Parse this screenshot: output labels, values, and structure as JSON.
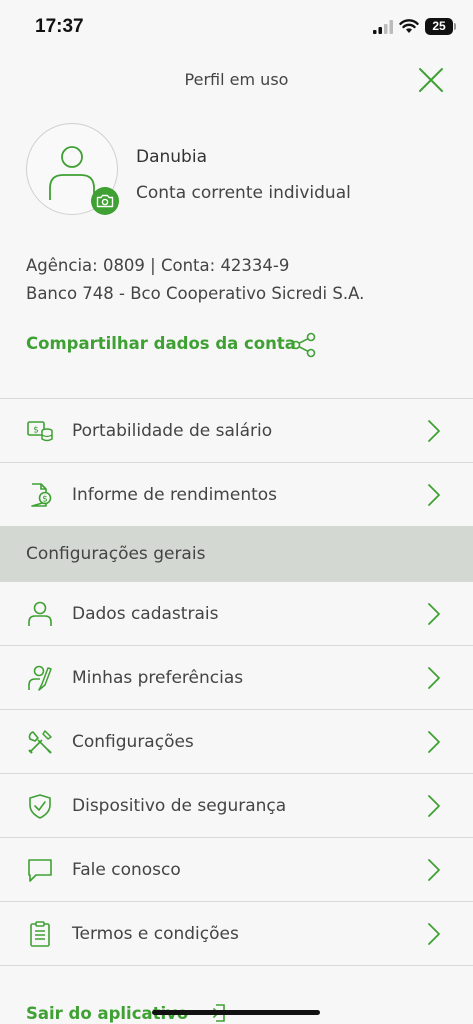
{
  "status_bar": {
    "time": "17:37",
    "battery_level": "25"
  },
  "header": {
    "title": "Perfil em uso"
  },
  "profile": {
    "name": "Danubia",
    "account_type": "Conta corrente individual",
    "agency_line": "Agência: 0809 | Conta: 42334-9",
    "bank_line": "Banco 748 - Bco Cooperativo Sicredi S.A.",
    "share_label": "Compartilhar dados da conta"
  },
  "menu_top": [
    {
      "label": "Portabilidade de salário",
      "icon": "salary-portability-icon"
    },
    {
      "label": "Informe de rendimentos",
      "icon": "income-report-icon"
    }
  ],
  "section": {
    "title": "Configurações gerais"
  },
  "menu_settings": [
    {
      "label": "Dados cadastrais",
      "icon": "user-icon"
    },
    {
      "label": "Minhas preferências",
      "icon": "preferences-icon"
    },
    {
      "label": "Configurações",
      "icon": "tools-icon"
    },
    {
      "label": "Dispositivo de segurança",
      "icon": "shield-icon"
    },
    {
      "label": "Fale conosco",
      "icon": "chat-icon"
    },
    {
      "label": "Termos e condições",
      "icon": "clipboard-icon"
    }
  ],
  "footer": {
    "logout_label": "Sair do aplicativo"
  },
  "colors": {
    "accent": "#3fa034",
    "section_bg": "#d4d8d3",
    "background": "#f7f7f7"
  }
}
